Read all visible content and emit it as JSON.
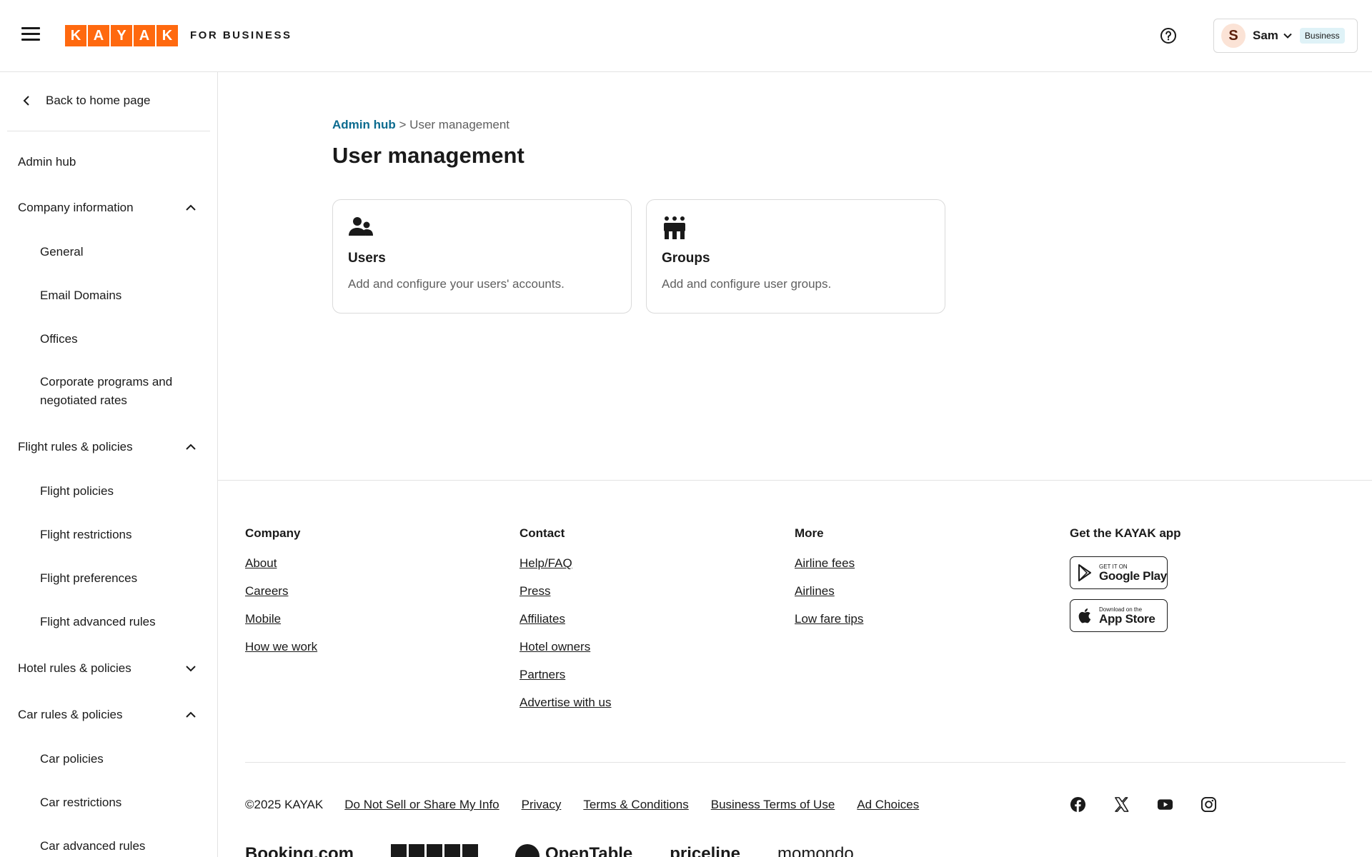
{
  "header": {
    "logo_letters": [
      "K",
      "A",
      "Y",
      "A",
      "K"
    ],
    "for_business": "FOR BUSINESS",
    "user_initial": "S",
    "user_name": "Sam",
    "badge": "Business",
    "brand_color": "#ff690f"
  },
  "sidebar": {
    "back_label": "Back to home page",
    "admin_hub": "Admin hub",
    "company_info": "Company information",
    "general": "General",
    "email_domains": "Email Domains",
    "offices": "Offices",
    "corporate_programs": "Corporate programs and negotiated rates",
    "flight_rules": "Flight rules & policies",
    "flight_policies": "Flight policies",
    "flight_restrictions": "Flight restrictions",
    "flight_preferences": "Flight preferences",
    "flight_advanced": "Flight advanced rules",
    "hotel_rules": "Hotel rules & policies",
    "car_rules": "Car rules & policies",
    "car_policies": "Car policies",
    "car_restrictions": "Car restrictions",
    "car_advanced": "Car advanced rules"
  },
  "main": {
    "breadcrumb_link": "Admin hub",
    "breadcrumb_sep": ">",
    "breadcrumb_current": "User management",
    "title": "User management",
    "cards": [
      {
        "title": "Users",
        "description": "Add and configure your users' accounts.",
        "icon": "users-icon"
      },
      {
        "title": "Groups",
        "description": "Add and configure user groups.",
        "icon": "groups-icon"
      }
    ]
  },
  "footer": {
    "company": {
      "heading": "Company",
      "links": [
        "About",
        "Careers",
        "Mobile",
        "How we work"
      ]
    },
    "contact": {
      "heading": "Contact",
      "links": [
        "Help/FAQ",
        "Press",
        "Affiliates",
        "Hotel owners",
        "Partners",
        "Advertise with us"
      ]
    },
    "more": {
      "heading": "More",
      "links": [
        "Airline fees",
        "Airlines",
        "Low fare tips"
      ]
    },
    "app": {
      "heading": "Get the KAYAK app",
      "google_small": "GET IT ON",
      "google_big": "Google Play",
      "apple_small": "Download on the",
      "apple_big": "App Store"
    },
    "copyright": "©2025 KAYAK",
    "legal_links": [
      "Do Not Sell or Share My Info",
      "Privacy",
      "Terms & Conditions",
      "Business Terms of Use",
      "Ad Choices"
    ],
    "social_icons": [
      "facebook-icon",
      "x-icon",
      "youtube-icon",
      "instagram-icon"
    ],
    "brands": [
      "Booking.com",
      "OpenTable",
      "priceline",
      "momondo"
    ]
  }
}
